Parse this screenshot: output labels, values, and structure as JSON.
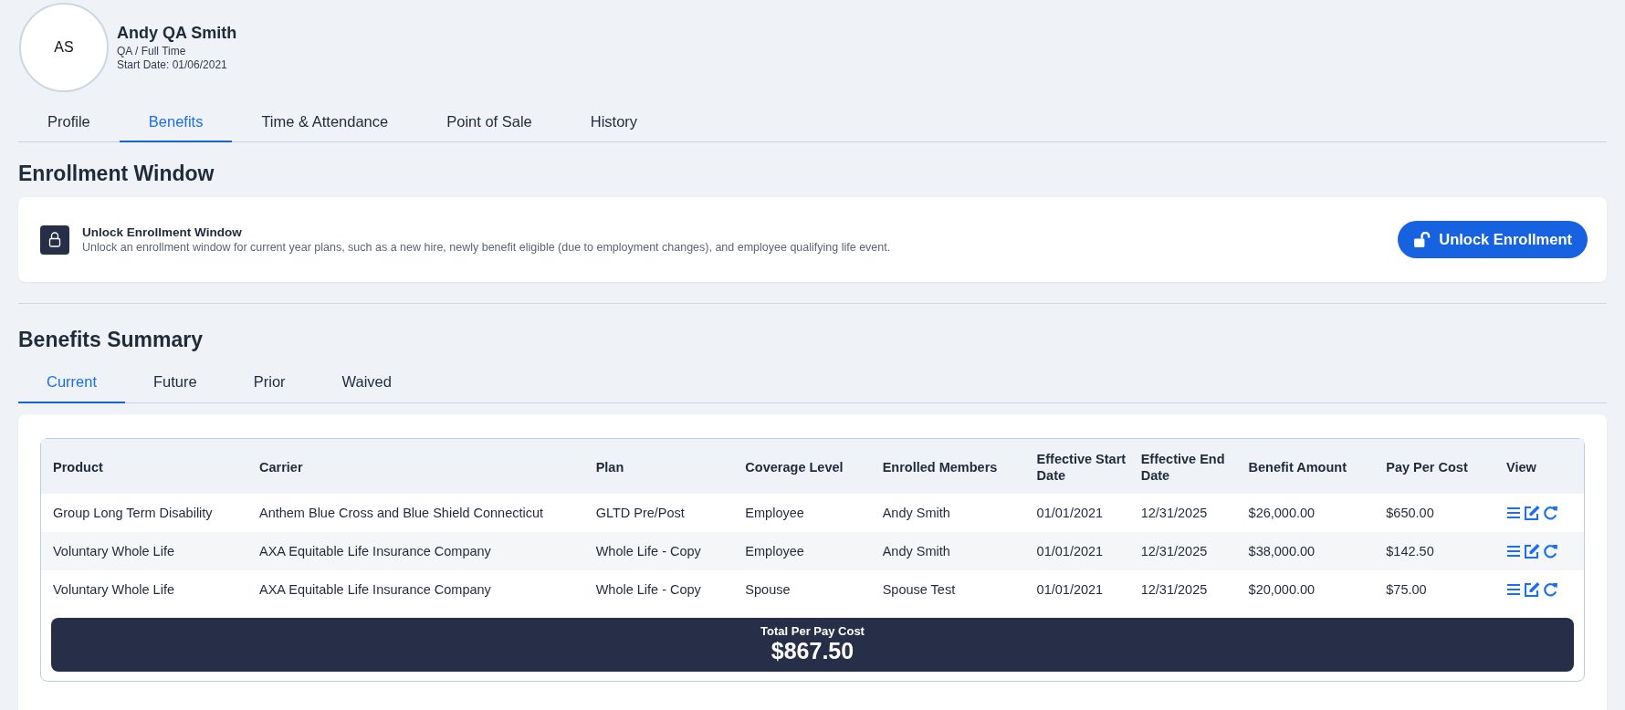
{
  "employee": {
    "initials": "AS",
    "name": "Andy QA Smith",
    "role": "QA / Full Time",
    "start_date": "Start Date: 01/06/2021"
  },
  "tabs": [
    {
      "label": "Profile",
      "selected": false
    },
    {
      "label": "Benefits",
      "selected": true
    },
    {
      "label": "Time & Attendance",
      "selected": false
    },
    {
      "label": "Point of Sale",
      "selected": false
    },
    {
      "label": "History",
      "selected": false
    }
  ],
  "enrollment": {
    "heading": "Enrollment Window",
    "title": "Unlock Enrollment Window",
    "description": "Unlock an enrollment window for current year plans, such as a new hire, newly benefit eligible (due to employment changes), and employee qualifying life event.",
    "button": "Unlock Enrollment"
  },
  "summary": {
    "heading": "Benefits Summary",
    "tabs": [
      {
        "label": "Current",
        "selected": true
      },
      {
        "label": "Future",
        "selected": false
      },
      {
        "label": "Prior",
        "selected": false
      },
      {
        "label": "Waived",
        "selected": false
      }
    ],
    "table": {
      "columns": [
        "Product",
        "Carrier",
        "Plan",
        "Coverage Level",
        "Enrolled Members",
        "Effective Start Date",
        "Effective End Date",
        "Benefit Amount",
        "Pay Per Cost",
        "View"
      ],
      "rows": [
        [
          "Group Long Term Disability",
          "Anthem Blue Cross and Blue Shield Connecticut",
          "GLTD Pre/Post",
          "Employee",
          "Andy Smith",
          "01/01/2021",
          "12/31/2025",
          "$26,000.00",
          "$650.00"
        ],
        [
          "Voluntary Whole Life",
          "AXA Equitable Life Insurance Company",
          "Whole Life - Copy",
          "Employee",
          "Andy Smith",
          "01/01/2021",
          "12/31/2025",
          "$38,000.00",
          "$142.50"
        ],
        [
          "Voluntary Whole Life",
          "AXA Equitable Life Insurance Company",
          "Whole Life - Copy",
          "Spouse",
          "Spouse Test",
          "01/01/2021",
          "12/31/2025",
          "$20,000.00",
          "$75.00"
        ]
      ]
    },
    "total": {
      "label": "Total Per Pay Cost",
      "value": "$867.50"
    }
  }
}
